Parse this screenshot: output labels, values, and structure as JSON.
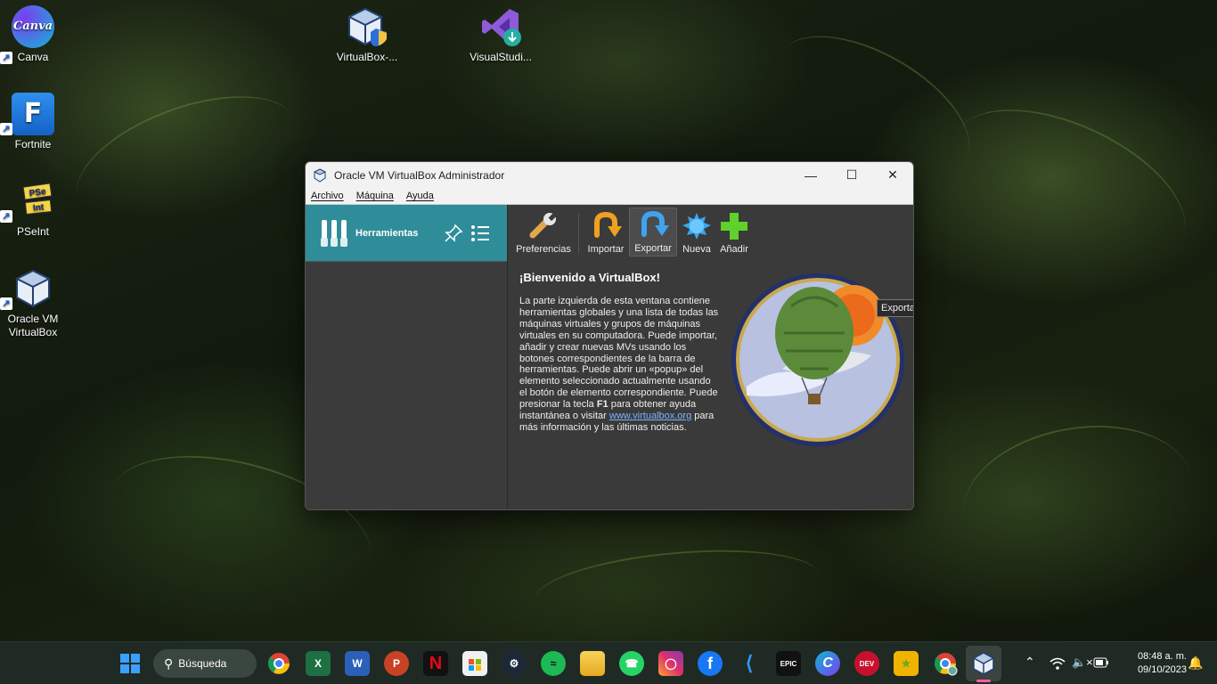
{
  "desktop": {
    "icons": [
      {
        "label": "Canva",
        "glyph": "Canva"
      },
      {
        "label": "Fortnite",
        "glyph": "F"
      },
      {
        "label": "PSeInt",
        "glyph_top": "PSe",
        "glyph_bottom": "Int"
      },
      {
        "label": "Oracle VM VirtualBox"
      },
      {
        "label": "VirtualBox-..."
      },
      {
        "label": "VisualStudi..."
      }
    ]
  },
  "window": {
    "title": "Oracle VM VirtualBox Administrador",
    "controls": {
      "minimize": "—",
      "maximize": "☐",
      "close": "✕"
    },
    "menu": [
      "Archivo",
      "Máquina",
      "Ayuda"
    ],
    "sidebar": {
      "tools_label": "Herramientas"
    },
    "toolbar": [
      {
        "label": "Preferencias",
        "icon": "wrench-icon"
      },
      {
        "label": "Importar",
        "icon": "import-arrow-icon"
      },
      {
        "label": "Exportar",
        "icon": "export-arrow-icon"
      },
      {
        "label": "Nueva",
        "icon": "new-star-icon"
      },
      {
        "label": "Añadir",
        "icon": "add-plus-icon"
      }
    ],
    "tooltip": "Exportar servicio virtualizado (Ctrl+E)",
    "welcome": {
      "title": "¡Bienvenido a VirtualBox!",
      "text_1": "La parte izquierda de esta ventana contiene herramientas globales y una lista de todas las máquinas virtuales y grupos de máquinas virtuales en su computadora. Puede importar, añadir y crear nuevas MVs usando los botones correspondientes de la barra de herramientas. Puede abrir un «popup» del elemento seleccionado actualmente usando el botón de elemento correspondiente. Puede presionar la tecla ",
      "key": "F1",
      "text_2": " para obtener ayuda instantánea o visitar ",
      "link": "www.virtualbox.org",
      "text_3": " para más información y las últimas noticias."
    }
  },
  "taskbar": {
    "search_label": "Búsqueda",
    "apps": [
      "windows-start",
      "chrome",
      "excel",
      "word",
      "powerpoint",
      "netflix",
      "microsoft-store",
      "steam",
      "spotify",
      "file-explorer",
      "whatsapp",
      "instagram",
      "facebook",
      "vscode",
      "epic-games",
      "canva",
      "devcpp",
      "game",
      "chrome-profile",
      "virtualbox"
    ],
    "clock_time": "08:48 a. m.",
    "clock_date": "09/10/2023",
    "colors": {
      "accent_active": "#ff5fa2"
    }
  }
}
